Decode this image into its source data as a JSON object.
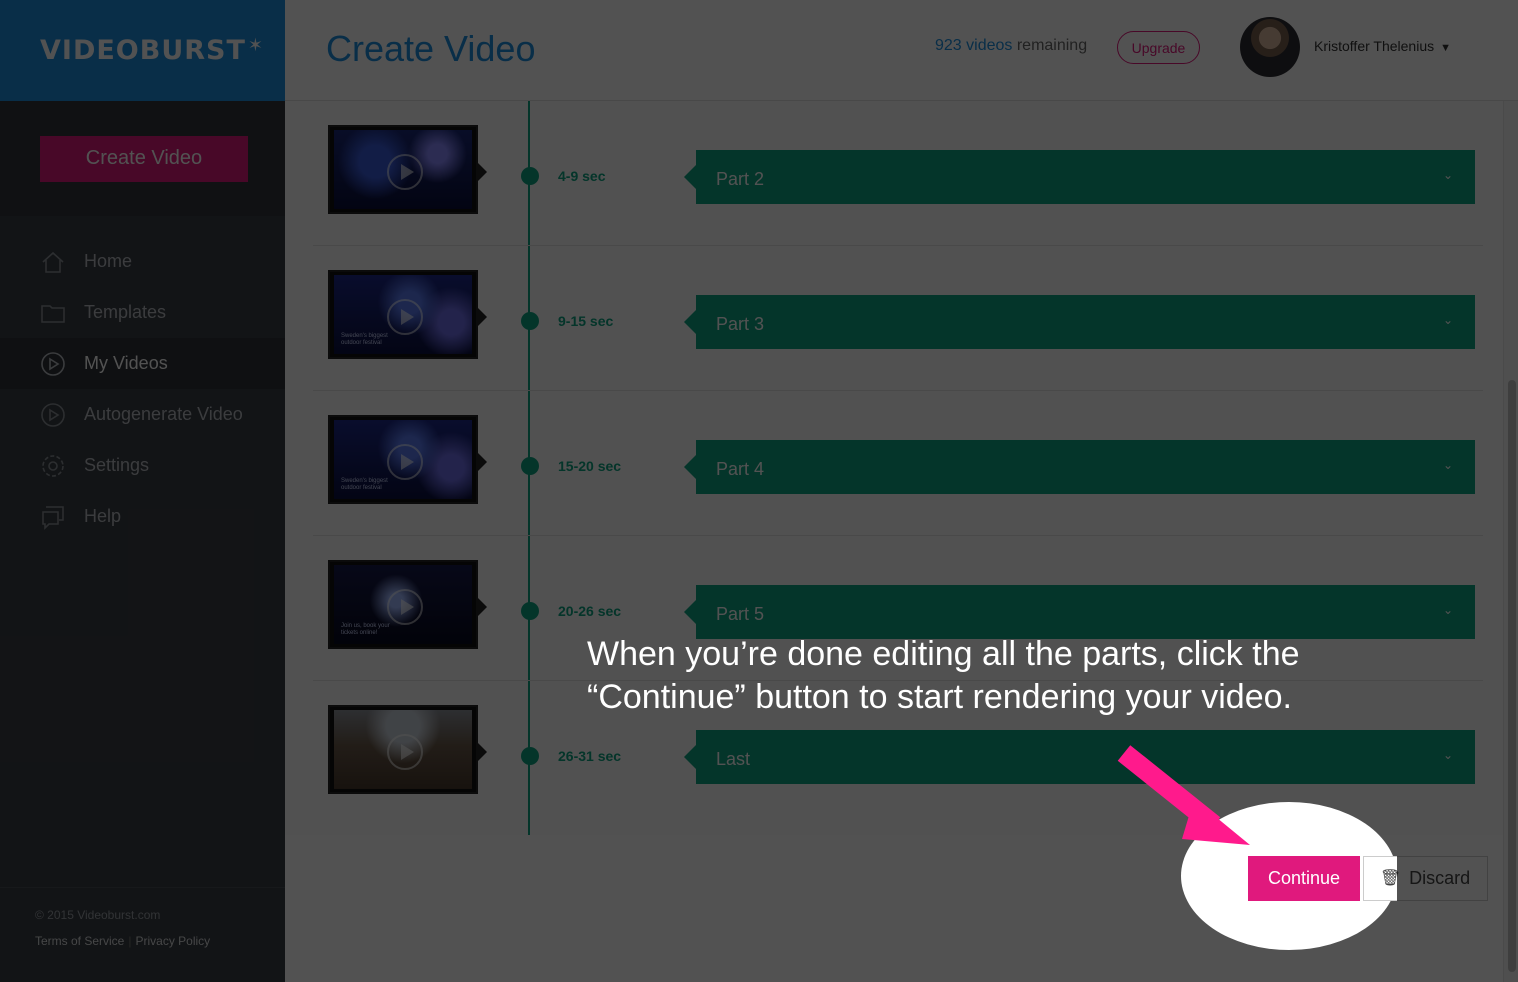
{
  "app": {
    "logo_text": "VIDEOBURST",
    "logo_star": "✶"
  },
  "sidebar": {
    "create_button": "Create Video",
    "items": [
      {
        "label": "Home",
        "icon": "home-icon"
      },
      {
        "label": "Templates",
        "icon": "folder-icon"
      },
      {
        "label": "My Videos",
        "icon": "play-circle-icon",
        "active": true
      },
      {
        "label": "Autogenerate Video",
        "icon": "play-circle-icon"
      },
      {
        "label": "Settings",
        "icon": "gear-icon"
      },
      {
        "label": "Help",
        "icon": "chat-icon"
      }
    ],
    "footer": {
      "copyright": "© 2015 Videoburst.com",
      "terms": "Terms of Service",
      "separator": "|",
      "privacy": "Privacy Policy"
    }
  },
  "header": {
    "title": "Create Video",
    "videos_count": "923 videos",
    "videos_suffix": "remaining",
    "upgrade": "Upgrade",
    "user_name": "Kristoffer Thelenius"
  },
  "parts": [
    {
      "time": "4-9 sec",
      "label": "Part 2",
      "caption": ""
    },
    {
      "time": "9-15 sec",
      "label": "Part 3",
      "caption": "Sweden's biggest outdoor festival"
    },
    {
      "time": "15-20 sec",
      "label": "Part 4",
      "caption": "Sweden's biggest outdoor festival"
    },
    {
      "time": "20-26 sec",
      "label": "Part 5",
      "caption": "Join us, book your tickets online!"
    },
    {
      "time": "26-31 sec",
      "label": "Last",
      "caption": ""
    }
  ],
  "actions": {
    "continue": "Continue",
    "discard": "Discard"
  },
  "tutorial": {
    "line1": "When you’re done editing all the parts, click the",
    "line2": "“Continue” button to start rendering your video."
  },
  "colors": {
    "brand_blue": "#1c8fe0",
    "accent_pink": "#e0197d",
    "timeline_green": "#0fa583"
  }
}
